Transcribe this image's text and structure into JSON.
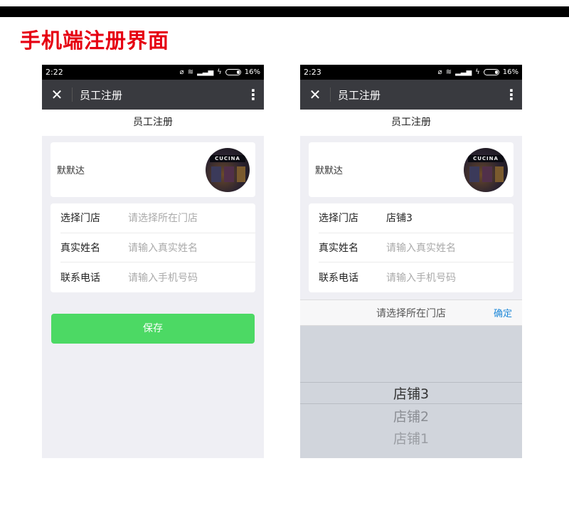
{
  "page_title": "手机端注册界面",
  "left": {
    "status": {
      "time": "2:22",
      "battery": "16%"
    },
    "nav": {
      "title": "员工注册"
    },
    "subheader": "员工注册",
    "user": {
      "name": "默默达",
      "avatar_sign": "CUCINA"
    },
    "form": [
      {
        "label": "选择门店",
        "value": "请选择所在门店"
      },
      {
        "label": "真实姓名",
        "value": "请输入真实姓名"
      },
      {
        "label": "联系电话",
        "value": "请输入手机号码"
      }
    ],
    "save_label": "保存"
  },
  "right": {
    "status": {
      "time": "2:23",
      "battery": "16%"
    },
    "nav": {
      "title": "员工注册"
    },
    "subheader": "员工注册",
    "user": {
      "name": "默默达",
      "avatar_sign": "CUCINA"
    },
    "form": [
      {
        "label": "选择门店",
        "value": "店铺3"
      },
      {
        "label": "真实姓名",
        "value": "请输入真实姓名"
      },
      {
        "label": "联系电话",
        "value": "请输入手机号码"
      }
    ],
    "picker": {
      "title": "请选择所在门店",
      "confirm": "确定",
      "options": [
        "店铺3",
        "店铺2",
        "店铺1"
      ],
      "selected": "店铺3"
    }
  },
  "colors": {
    "accent_title": "#e60012",
    "save_button": "#4cd964",
    "confirm_link": "#1e88d8",
    "navbar": "#393a3f"
  },
  "icons": [
    "close-icon",
    "more-icon",
    "mute-icon",
    "wifi-icon",
    "signal-icon",
    "battery-icon"
  ]
}
